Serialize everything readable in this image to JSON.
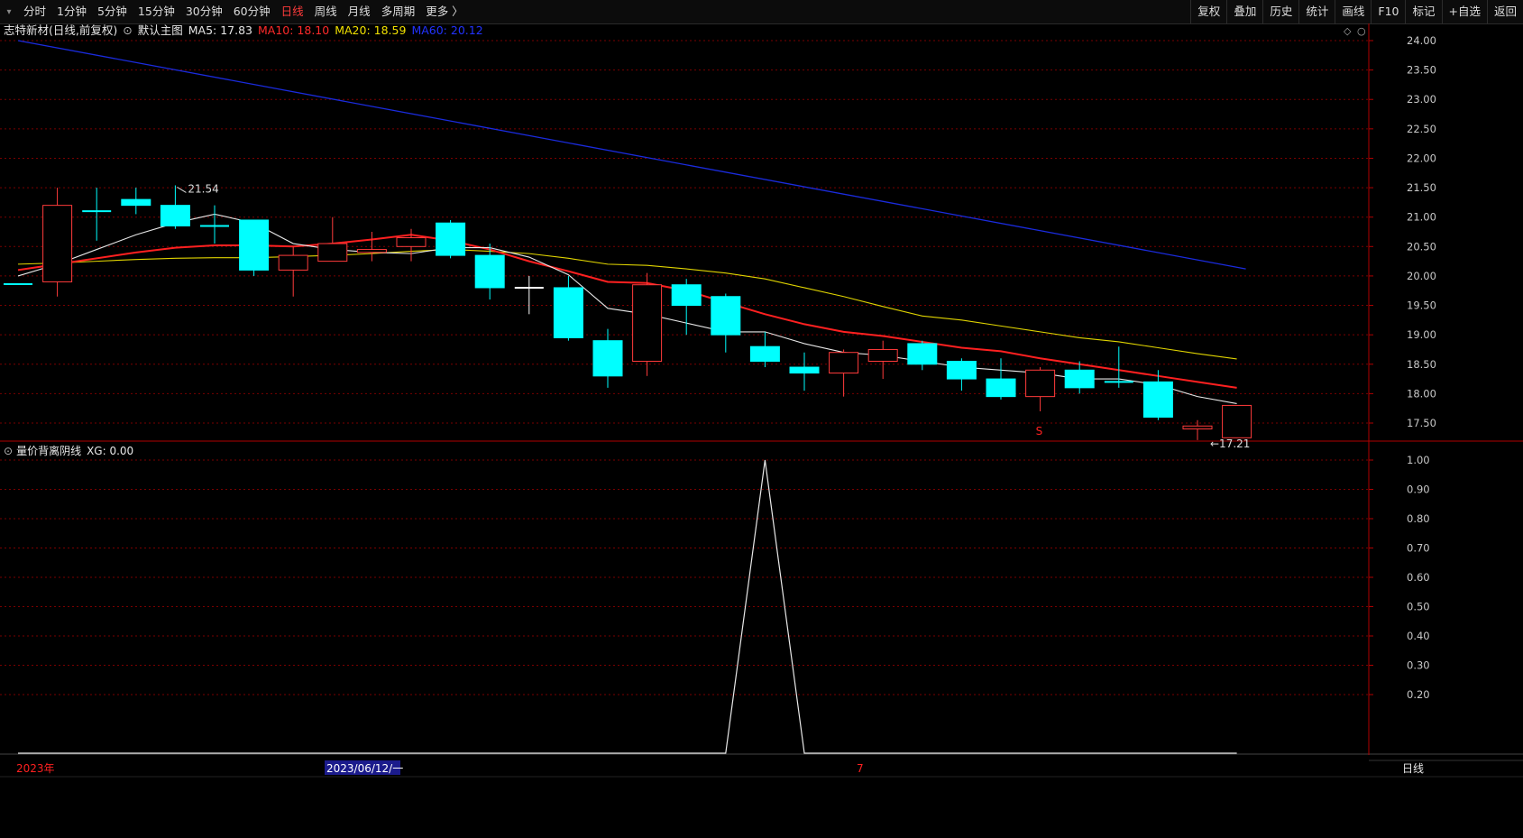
{
  "toolbar": {
    "periods": [
      "分时",
      "1分钟",
      "5分钟",
      "15分钟",
      "30分钟",
      "60分钟",
      "日线",
      "周线",
      "月线",
      "多周期",
      "更多 〉"
    ],
    "active_period": "日线",
    "right_tools": [
      "复权",
      "叠加",
      "历史",
      "统计",
      "画线",
      "F10",
      "标记",
      "+自选",
      "返回"
    ]
  },
  "main_chart": {
    "stock_title": "志特新材(日线,前复权)",
    "template": "默认主图",
    "ma_labels": [
      {
        "text": "MA5: 17.83",
        "color": "#e6e6e6"
      },
      {
        "text": "MA10: 18.10",
        "color": "#ff2a2a"
      },
      {
        "text": "MA20: 18.59",
        "color": "#f0e000"
      },
      {
        "text": "MA60: 20.12",
        "color": "#2233ff"
      }
    ],
    "y_ticks": [
      "24.00",
      "23.50",
      "23.00",
      "22.50",
      "22.00",
      "21.50",
      "21.00",
      "20.50",
      "20.00",
      "19.50",
      "19.00",
      "18.50",
      "18.00",
      "17.50"
    ],
    "high_label": "21.54",
    "low_label": "17.21",
    "signal_mark": "S",
    "candles": [
      [
        19.86,
        19.86,
        19.86,
        19.86
      ],
      [
        19.9,
        21.2,
        21.5,
        19.65
      ],
      [
        21.1,
        21.1,
        21.5,
        20.6
      ],
      [
        21.3,
        21.2,
        21.5,
        21.05
      ],
      [
        21.2,
        20.85,
        21.54,
        20.8
      ],
      [
        20.85,
        20.85,
        21.2,
        20.55
      ],
      [
        20.95,
        20.1,
        20.95,
        20.0
      ],
      [
        20.1,
        20.35,
        20.5,
        19.65
      ],
      [
        20.25,
        20.55,
        21.0,
        20.25
      ],
      [
        20.4,
        20.45,
        20.75,
        20.25
      ],
      [
        20.5,
        20.65,
        20.8,
        20.25
      ],
      [
        20.9,
        20.35,
        20.95,
        20.3
      ],
      [
        20.35,
        19.8,
        20.55,
        19.6
      ],
      [
        19.8,
        19.8,
        20.0,
        19.35
      ],
      [
        19.8,
        18.95,
        20.0,
        18.9
      ],
      [
        18.9,
        18.3,
        19.1,
        18.1
      ],
      [
        18.55,
        19.85,
        20.05,
        18.3
      ],
      [
        19.85,
        19.5,
        19.95,
        19.0
      ],
      [
        19.65,
        19.0,
        19.7,
        18.7
      ],
      [
        18.8,
        18.55,
        19.05,
        18.45
      ],
      [
        18.45,
        18.35,
        18.7,
        18.05
      ],
      [
        18.35,
        18.7,
        18.75,
        17.95
      ],
      [
        18.55,
        18.75,
        18.9,
        18.25
      ],
      [
        18.85,
        18.5,
        18.9,
        18.4
      ],
      [
        18.55,
        18.25,
        18.6,
        18.05
      ],
      [
        18.25,
        17.95,
        18.6,
        17.9
      ],
      [
        17.95,
        18.4,
        18.45,
        17.7
      ],
      [
        18.4,
        18.1,
        18.55,
        18.0
      ],
      [
        18.2,
        18.2,
        18.8,
        18.1
      ],
      [
        18.2,
        17.6,
        18.4,
        17.55
      ],
      [
        17.4,
        17.45,
        17.55,
        17.21
      ],
      [
        17.25,
        17.8,
        17.8,
        17.25
      ]
    ],
    "ma5": [
      20.0,
      20.2,
      20.45,
      20.7,
      20.9,
      21.05,
      20.9,
      20.55,
      20.45,
      20.4,
      20.38,
      20.48,
      20.48,
      20.32,
      20.02,
      19.45,
      19.35,
      19.2,
      19.05,
      19.05,
      18.85,
      18.7,
      18.65,
      18.55,
      18.45,
      18.4,
      18.35,
      18.25,
      18.25,
      18.15,
      17.95,
      17.83
    ],
    "ma10": [
      20.1,
      20.2,
      20.3,
      20.4,
      20.48,
      20.52,
      20.52,
      20.5,
      20.55,
      20.62,
      20.7,
      20.6,
      20.45,
      20.25,
      20.08,
      19.9,
      19.88,
      19.75,
      19.55,
      19.35,
      19.18,
      19.05,
      18.98,
      18.88,
      18.78,
      18.72,
      18.6,
      18.5,
      18.4,
      18.3,
      18.2,
      18.1
    ],
    "ma20": [
      20.2,
      20.22,
      20.25,
      20.28,
      20.3,
      20.31,
      20.31,
      20.33,
      20.35,
      20.38,
      20.42,
      20.45,
      20.42,
      20.38,
      20.3,
      20.2,
      20.18,
      20.12,
      20.05,
      19.95,
      19.8,
      19.65,
      19.48,
      19.32,
      19.25,
      19.15,
      19.05,
      18.95,
      18.88,
      18.78,
      18.68,
      18.59
    ],
    "ma60_start": 24.0,
    "ma60_end": 20.12,
    "y_min": 17.0,
    "y_max": 24.2
  },
  "indicator": {
    "title": "量价背离阴线",
    "value_label": "XG: 0.00",
    "y_ticks": [
      "1.00",
      "0.90",
      "0.80",
      "0.70",
      "0.60",
      "0.50",
      "0.40",
      "0.30",
      "0.20"
    ],
    "values": [
      0,
      0,
      0,
      0,
      0,
      0,
      0,
      0,
      0,
      0,
      0,
      0,
      0,
      0,
      0,
      0,
      0,
      0,
      0,
      1,
      0,
      0,
      0,
      0,
      0,
      0,
      0,
      0,
      0,
      0,
      0,
      0
    ]
  },
  "bottom": {
    "year_label": "2023年",
    "date_label": "2023/06/12/一",
    "month_mark": "7",
    "period_label": "日线"
  },
  "colors": {
    "up": "#ff3b3b",
    "down": "#00ffff",
    "grid": "#7a0000",
    "axis": "#b00000"
  }
}
